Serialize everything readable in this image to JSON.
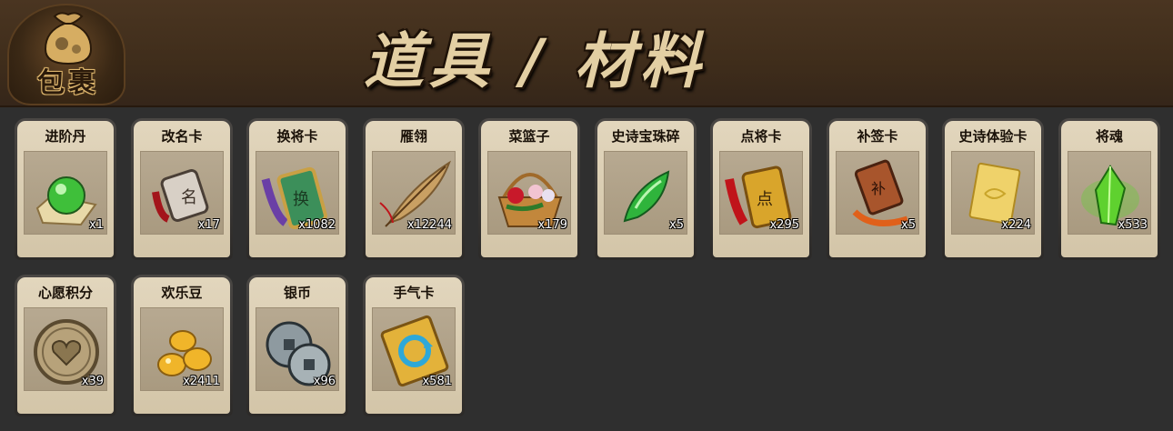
{
  "header": {
    "badge_label": "包裹",
    "title": "道具 / 材料"
  },
  "items": [
    {
      "name": "进阶丹",
      "count": "x1",
      "icon": "green-orb-pill-icon",
      "color": "#3fbf3a"
    },
    {
      "name": "改名卡",
      "count": "x17",
      "icon": "rename-token-icon",
      "color": "#9a8f86"
    },
    {
      "name": "换将卡",
      "count": "x1082",
      "icon": "jade-general-card-icon",
      "color": "#3c8f5a"
    },
    {
      "name": "雁翎",
      "count": "x12244",
      "icon": "feather-icon",
      "color": "#c9a063"
    },
    {
      "name": "菜篮子",
      "count": "x179",
      "icon": "flower-basket-icon",
      "color": "#c2873c"
    },
    {
      "name": "史诗宝珠碎",
      "count": "x5",
      "icon": "green-shard-icon",
      "color": "#2fb43c"
    },
    {
      "name": "点将卡",
      "count": "x295",
      "icon": "golden-summon-card-icon",
      "color": "#d9a52b"
    },
    {
      "name": "补签卡",
      "count": "x5",
      "icon": "bronze-sign-card-icon",
      "color": "#a8552c"
    },
    {
      "name": "史诗体验卡",
      "count": "x224",
      "icon": "gold-ticket-icon",
      "color": "#efd26a"
    },
    {
      "name": "将魂",
      "count": "x533",
      "icon": "green-soul-crystal-icon",
      "color": "#5fd12f"
    },
    {
      "name": "心愿积分",
      "count": "x39",
      "icon": "heart-coin-icon",
      "color": "#b7a27a"
    },
    {
      "name": "欢乐豆",
      "count": "x2411",
      "icon": "golden-beans-icon",
      "color": "#f0b52a"
    },
    {
      "name": "银币",
      "count": "x96",
      "icon": "silver-coins-icon",
      "color": "#8e9aa0"
    },
    {
      "name": "手气卡",
      "count": "x581",
      "icon": "luck-card-icon",
      "color": "#e3b23a"
    }
  ]
}
